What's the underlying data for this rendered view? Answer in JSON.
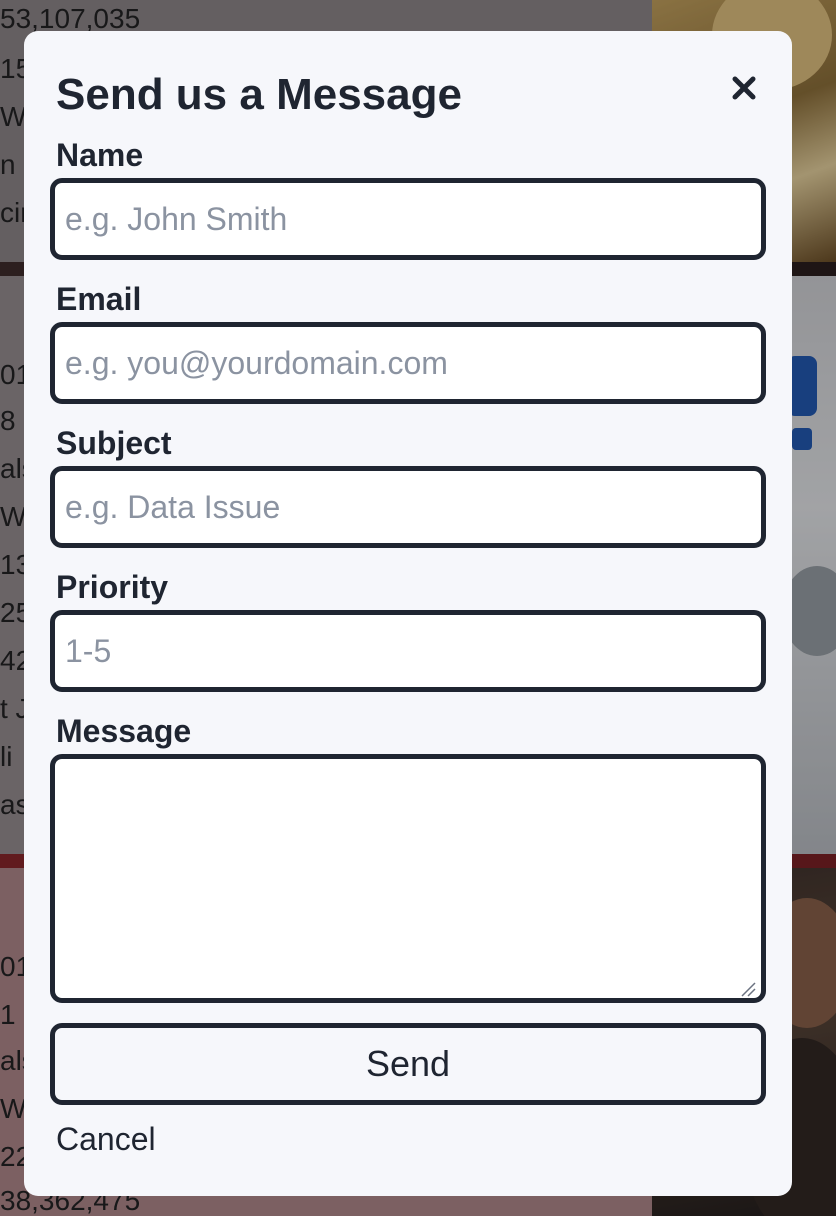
{
  "background": {
    "visible_text": [
      "53,107,035",
      "15",
      "Wa",
      "n u",
      "cir",
      "01",
      "8",
      "als",
      "Wo",
      "13",
      "25",
      "42",
      "t J",
      "li",
      "as",
      "01",
      "1",
      "als",
      "Wo",
      "22",
      "38,362,475"
    ]
  },
  "modal": {
    "title": "Send us a Message",
    "close_icon": "close-icon",
    "fields": {
      "name": {
        "label": "Name",
        "placeholder": "e.g. John Smith",
        "value": ""
      },
      "email": {
        "label": "Email",
        "placeholder": "e.g. you@yourdomain.com",
        "value": ""
      },
      "subject": {
        "label": "Subject",
        "placeholder": "e.g. Data Issue",
        "value": ""
      },
      "priority": {
        "label": "Priority",
        "placeholder": "1-5",
        "value": ""
      },
      "message": {
        "label": "Message",
        "placeholder": "",
        "value": ""
      }
    },
    "send_label": "Send",
    "cancel_label": "Cancel"
  },
  "colors": {
    "modal_bg": "#f6f7fb",
    "text": "#1f2531",
    "border": "#1f2531",
    "placeholder": "#8b93a1"
  }
}
